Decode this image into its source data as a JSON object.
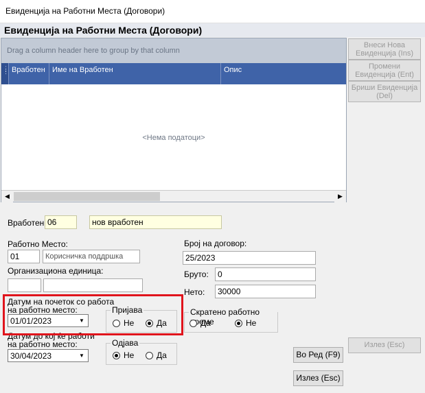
{
  "window": {
    "title": "Евиденција на Работни Места (Договори)"
  },
  "form_header": "Евиденција на Работни Места (Договори)",
  "grid": {
    "group_hint": "Drag a column header here to group by that column",
    "columns": [
      "Вработен",
      "Име на Вработен",
      "Опис"
    ],
    "empty_text": "<Нема податоци>"
  },
  "side_buttons": {
    "add": "Внеси Нова Евиденција (Ins)",
    "edit": "Промени Евиденција (Ent)",
    "delete": "Бриши Евиденција (Del)",
    "exit_disabled": "Излез (Esc)"
  },
  "fields": {
    "employee_label": "Вработен",
    "employee_id": "06",
    "employee_name": "нов вработен",
    "workplace_label": "Работно Место:",
    "workplace_code": "01",
    "workplace_name": "Корисничка поддршка",
    "org_unit_label": "Организациона единица:",
    "org_unit_code": "",
    "org_unit_name": "",
    "contract_no_label": "Број на договор:",
    "contract_no": "25/2023",
    "gross_label": "Бруто:",
    "gross": "0",
    "net_label": "Нето:",
    "net": "30000",
    "start_date_label_1": "Датум на почеток со работа",
    "start_date_label_2": "на работно место:",
    "start_date": "01/01/2023",
    "end_date_label_1": "Датум до кој ќе работи",
    "end_date_label_2": "на работно место:",
    "end_date": "30/04/2023"
  },
  "groups": {
    "registration": {
      "title": "Пријава",
      "no": "Не",
      "yes": "Да",
      "selected": "yes"
    },
    "deregistration": {
      "title": "Одјава",
      "no": "Не",
      "yes": "Да",
      "selected": "no"
    },
    "short_time": {
      "title": "Скратено работно време",
      "yes": "Да",
      "no": "Не",
      "selected": "no"
    }
  },
  "buttons": {
    "ok": "Во Ред (F9)",
    "exit": "Излез (Esc)"
  },
  "colors": {
    "grid_header": "#3f63a8",
    "group_panel": "#c2cad6",
    "highlight": "#e0141c",
    "yellow_field": "#ffffe1"
  }
}
